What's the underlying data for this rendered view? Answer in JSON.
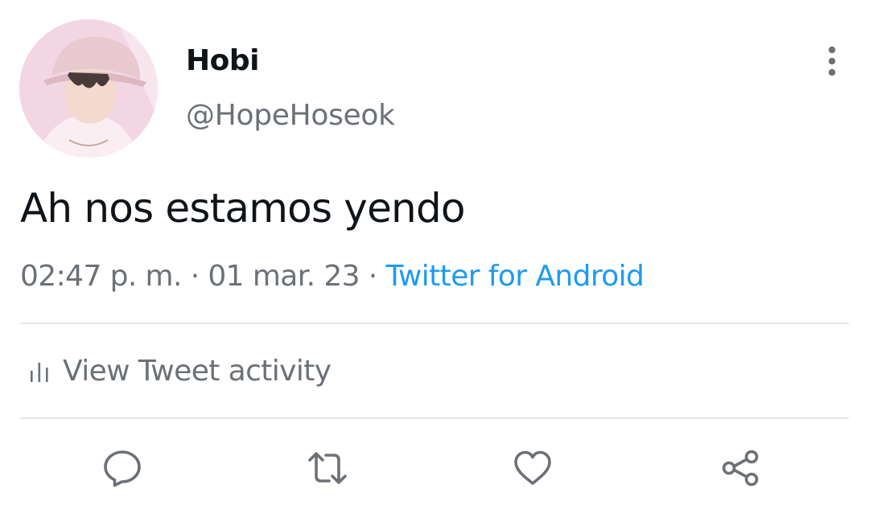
{
  "author": {
    "display_name": "Hobi",
    "handle": "@HopeHoseok"
  },
  "tweet": {
    "text": "Ah nos estamos yendo",
    "time": "02:47 p. m.",
    "date": "01 mar. 23",
    "source": "Twitter for Android",
    "separator": "·"
  },
  "activity": {
    "label": "View Tweet activity",
    "icon": "bar-chart-icon"
  },
  "actions": [
    {
      "icon": "reply-icon"
    },
    {
      "icon": "retweet-icon"
    },
    {
      "icon": "like-heart-icon"
    },
    {
      "icon": "share-icon"
    }
  ],
  "more_icon": "more-vertical-icon",
  "colors": {
    "text": "#0f1419",
    "secondary": "#6b7177",
    "link": "#1d9bf0",
    "divider": "#e4e7ea"
  }
}
